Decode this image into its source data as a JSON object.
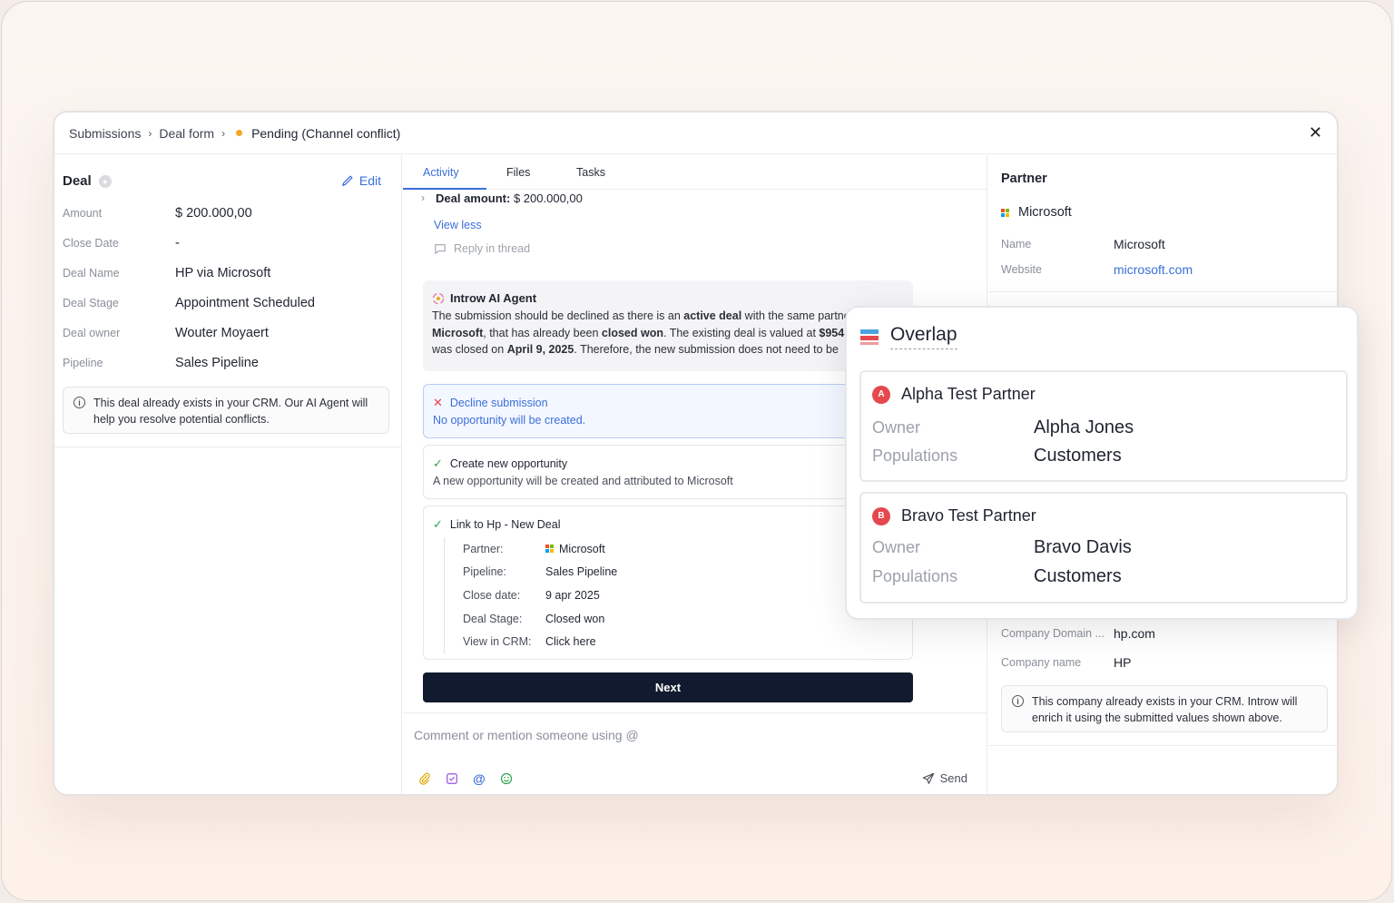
{
  "breadcrumb": {
    "items": [
      "Submissions",
      "Deal form"
    ],
    "status": "Pending (Channel conflict)",
    "status_color": "#f5a524"
  },
  "deal": {
    "title": "Deal",
    "edit_label": "Edit",
    "fields": [
      {
        "label": "Amount",
        "value": "$ 200.000,00"
      },
      {
        "label": "Close Date",
        "value": "-"
      },
      {
        "label": "Deal Name",
        "value": "HP via Microsoft"
      },
      {
        "label": "Deal Stage",
        "value": "Appointment Scheduled"
      },
      {
        "label": "Deal owner",
        "value": "Wouter Moyaert"
      },
      {
        "label": "Pipeline",
        "value": "Sales Pipeline"
      }
    ],
    "info": "This deal already exists in your CRM. Our AI Agent will help you resolve potential conflicts."
  },
  "tabs": [
    {
      "label": "Activity",
      "active": true
    },
    {
      "label": "Files",
      "active": false
    },
    {
      "label": "Tasks",
      "active": false
    }
  ],
  "activity": {
    "deal_amount_label": "Deal amount:",
    "deal_amount_value": "$ 200.000,00",
    "view_less": "View less",
    "reply": "Reply in thread",
    "ai_title": "Introw AI Agent",
    "ai_line1_a": "The submission should be declined as there is an ",
    "ai_line1_b": "active deal",
    "ai_line1_c": " with the same partner",
    "ai_line2_a": "Microsoft",
    "ai_line2_b": ", that has already been ",
    "ai_line2_c": "closed won",
    "ai_line2_d": ". The existing deal is valued at ",
    "ai_line2_e": "$954",
    "ai_line3_a": "was closed on ",
    "ai_line3_b": "April 9, 2025",
    "ai_line3_c": ". Therefore, the new submission does not need to be",
    "options": [
      {
        "title": "Decline submission",
        "sub": "No opportunity will be created.",
        "selected": true
      },
      {
        "title": "Create new opportunity",
        "sub": "A new opportunity will be created and attributed to Microsoft",
        "selected": false
      },
      {
        "title": "Link to Hp - New Deal",
        "selected": false
      }
    ],
    "link_details": [
      {
        "label": "Partner:",
        "value": "Microsoft"
      },
      {
        "label": "Pipeline:",
        "value": "Sales Pipeline"
      },
      {
        "label": "Close date:",
        "value": "9 apr 2025"
      },
      {
        "label": "Deal Stage:",
        "value": "Closed won"
      },
      {
        "label": "View in CRM:",
        "value": "Click here"
      }
    ],
    "next_label": "Next"
  },
  "comment": {
    "placeholder": "Comment or mention someone using @",
    "send_label": "Send",
    "icons": [
      "paperclip-icon",
      "task-icon",
      "at-icon",
      "emoji-icon"
    ]
  },
  "partner": {
    "title": "Partner",
    "name": "Microsoft",
    "fields": [
      {
        "label": "Name",
        "value": "Microsoft"
      },
      {
        "label": "Website",
        "value": "microsoft.com"
      }
    ],
    "company_fields": [
      {
        "label": "Company Domain ...",
        "value": "hp.com"
      },
      {
        "label": "Company name",
        "value": "HP"
      }
    ],
    "info": "This company already exists in your CRM. Introw will enrich it using the submitted values shown above."
  },
  "overlap": {
    "title": "Overlap",
    "partners": [
      {
        "badge": "A",
        "name": "Alpha Test Partner",
        "owner_label": "Owner",
        "owner": "Alpha Jones",
        "populations_label": "Populations",
        "populations": "Customers"
      },
      {
        "badge": "B",
        "name": "Bravo Test Partner",
        "owner_label": "Owner",
        "owner": "Bravo Davis",
        "populations_label": "Populations",
        "populations": "Customers"
      }
    ]
  },
  "colors": {
    "accent": "#3b6fd9",
    "dark_button": "#111a2e",
    "success": "#2ea44f",
    "danger": "#e5484d",
    "ms_red": "#f25022",
    "ms_green": "#7fba00",
    "ms_blue": "#00a4ef",
    "ms_yellow": "#ffb900"
  }
}
